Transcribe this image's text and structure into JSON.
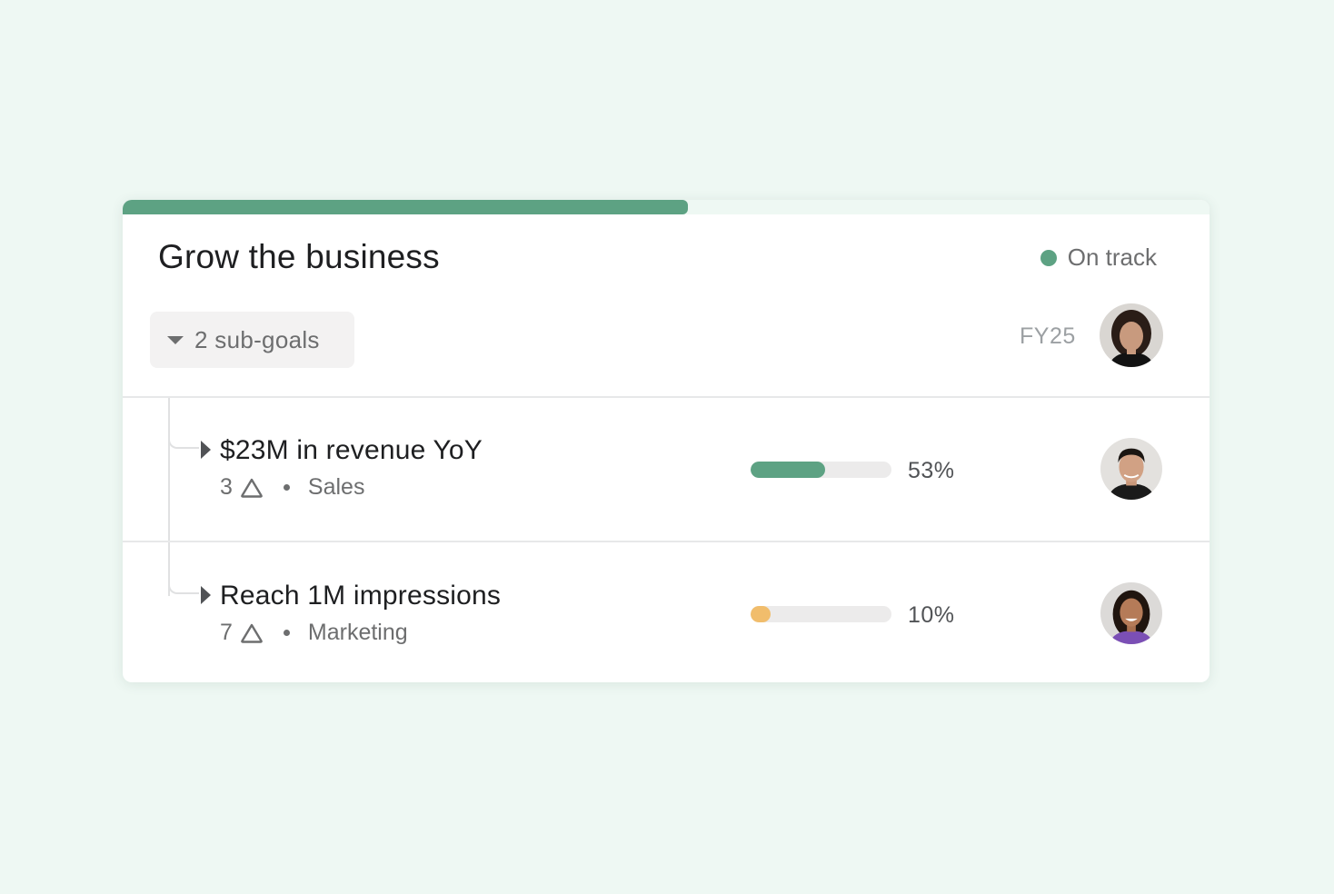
{
  "goal": {
    "title": "Grow the business",
    "progress": 0.52,
    "status": {
      "label": "On track",
      "color": "#5da283"
    },
    "subgoals_label": "2 sub-goals",
    "period": "FY25",
    "owner_avatar": "avatar-woman-curly-hair"
  },
  "subgoals": [
    {
      "title": "$23M in revenue YoY",
      "count": "3",
      "count_icon": "warning-triangle-icon",
      "team": "Sales",
      "progress": 0.53,
      "progress_label": "53%",
      "bar_color": "#5da283",
      "owner_avatar": "avatar-man-short-hair"
    },
    {
      "title": "Reach 1M impressions",
      "count": "7",
      "count_icon": "warning-triangle-icon",
      "team": "Marketing",
      "progress": 0.1,
      "progress_label": "10%",
      "bar_color": "#f1bd6c",
      "owner_avatar": "avatar-woman-long-hair"
    }
  ]
}
